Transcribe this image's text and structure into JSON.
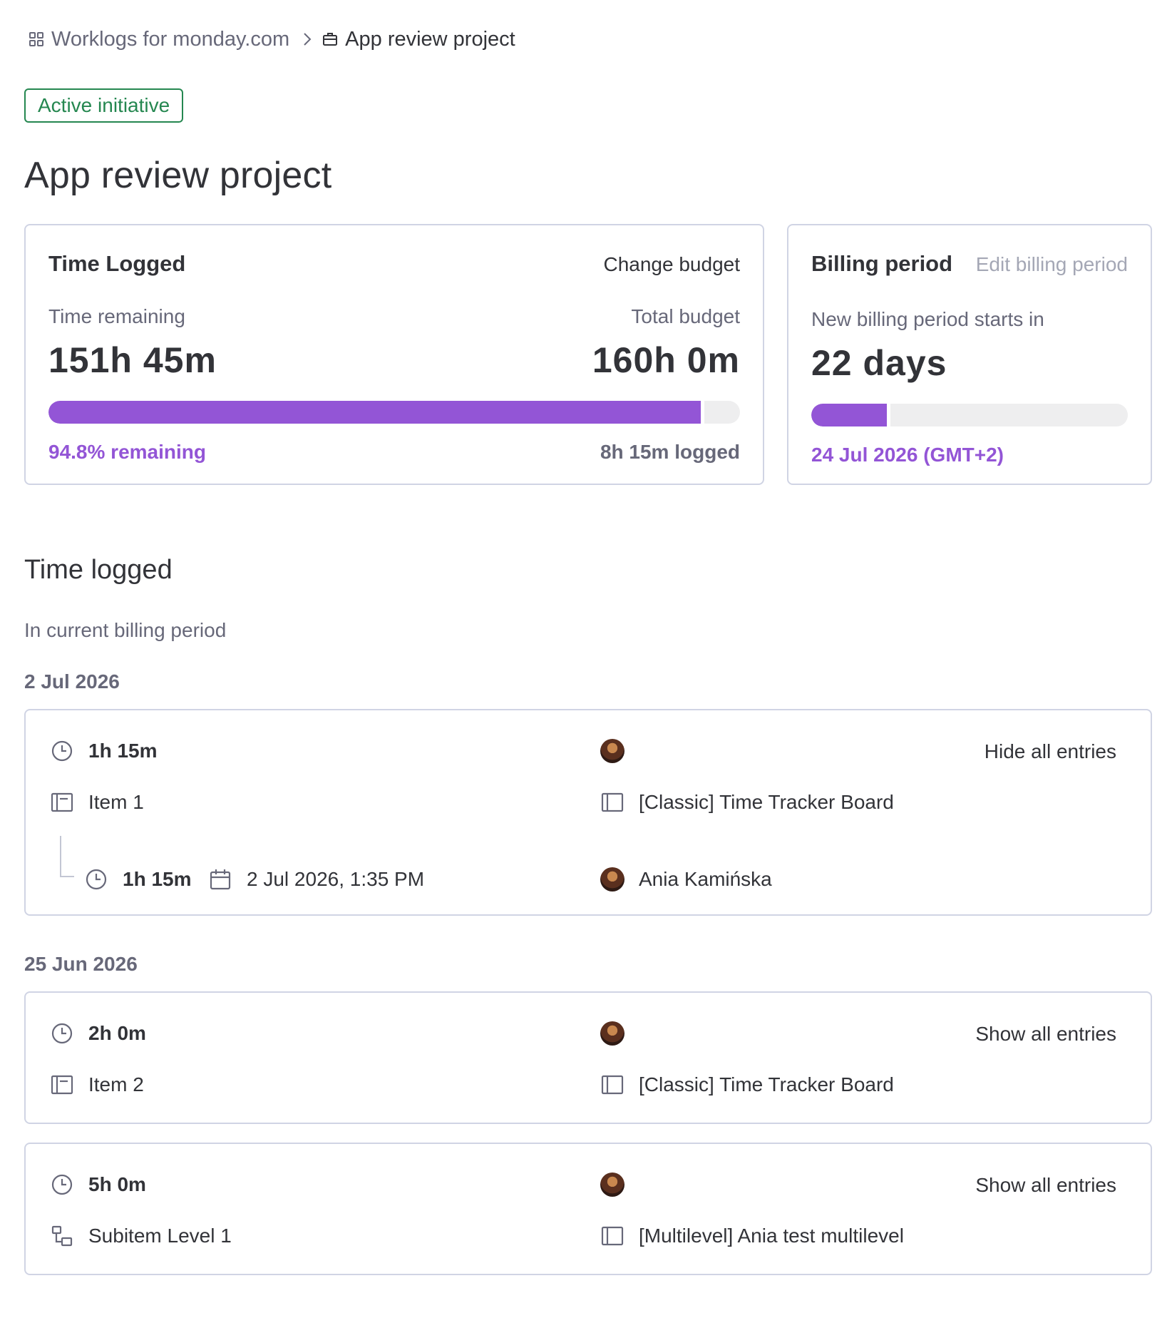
{
  "breadcrumb": {
    "root_label": "Worklogs for monday.com",
    "root_icon": "apps-grid-icon",
    "current_label": "App review project",
    "current_icon": "briefcase-icon"
  },
  "status_chip": "Active initiative",
  "page_title": "App review project",
  "time_card": {
    "title": "Time Logged",
    "change_budget": "Change budget",
    "remaining_label": "Time remaining",
    "total_label": "Total budget",
    "remaining_value": "151h 45m",
    "total_value": "160h 0m",
    "remaining_fraction": 0.948,
    "remaining_percent_text": "94.8% remaining",
    "logged_text": "8h 15m logged"
  },
  "billing_card": {
    "title": "Billing period",
    "edit_link": "Edit billing period",
    "starts_label": "New billing period starts in",
    "days_value": "22 days",
    "elapsed_fraction": 0.25,
    "next_date": "24 Jul 2026 (GMT+2)"
  },
  "section": {
    "title": "Time logged",
    "subtitle": "In current billing period"
  },
  "groups": [
    {
      "date": "2 Jul 2026",
      "entries": [
        {
          "duration": "1h 15m",
          "item": "Item 1",
          "item_icon": "item-icon",
          "board": "[Classic] Time Tracker Board",
          "toggle": "Hide all entries",
          "sub_entries": [
            {
              "duration": "1h 15m",
              "datetime": "2 Jul 2026, 1:35 PM",
              "user": "Ania Kamińska"
            }
          ]
        }
      ]
    },
    {
      "date": "25 Jun 2026",
      "entries": [
        {
          "duration": "2h 0m",
          "item": "Item 2",
          "item_icon": "item-icon",
          "board": "[Classic] Time Tracker Board",
          "toggle": "Show all entries"
        },
        {
          "duration": "5h 0m",
          "item": "Subitem Level 1",
          "item_icon": "subitem-icon",
          "board": "[Multilevel] Ania test multilevel",
          "toggle": "Show all entries"
        }
      ]
    }
  ],
  "colors": {
    "accent": "#9355d6",
    "active_green": "#258750",
    "border": "#d0d4e4",
    "muted_text": "#676879"
  }
}
